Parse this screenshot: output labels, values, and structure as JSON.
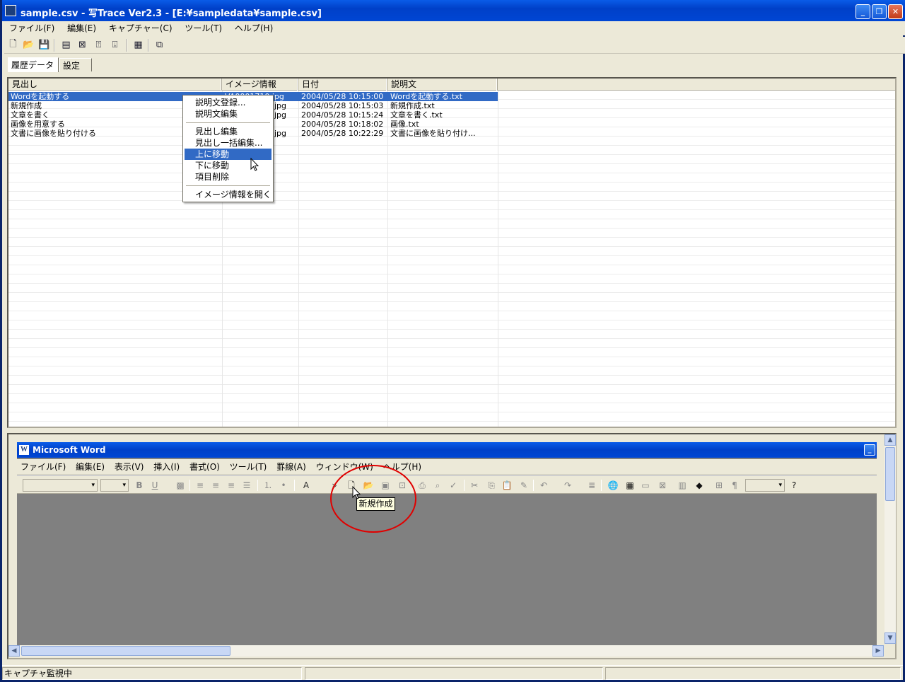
{
  "window": {
    "title": "sample.csv - 写Trace Ver2.3 - [E:¥sampledata¥sample.csv]",
    "min": "_",
    "max": "❐",
    "close": "✕"
  },
  "menubar": {
    "items": [
      "ファイル(F)",
      "編集(E)",
      "キャプチャー(C)",
      "ツール(T)",
      "ヘルプ(H)"
    ]
  },
  "tabs": [
    {
      "label": "履歴データ"
    },
    {
      "label": "設定"
    }
  ],
  "list": {
    "columns": [
      "見出し",
      "イメージ情報",
      "日付",
      "説明文"
    ],
    "rows": [
      {
        "title": "Wordを起動する",
        "image": "VA0001710.jpg",
        "date": "2004/05/28 10:15:00",
        "desc": "Wordを起動する.txt"
      },
      {
        "title": "新規作成",
        "image": "jpg",
        "date": "2004/05/28 10:15:03",
        "desc": "新規作成.txt"
      },
      {
        "title": "文章を書く",
        "image": "jpg",
        "date": "2004/05/28 10:15:24",
        "desc": "文章を書く.txt"
      },
      {
        "title": "画像を用意する",
        "image": "",
        "date": "2004/05/28 10:18:02",
        "desc": "画像.txt"
      },
      {
        "title": "文書に画像を貼り付ける",
        "image": "jpg",
        "date": "2004/05/28 10:22:29",
        "desc": "文書に画像を貼り付け..."
      }
    ]
  },
  "context_menu": {
    "items": [
      "説明文登録...",
      "説明文編集",
      "見出し編集",
      "見出し一括編集...",
      "上に移動",
      "下に移動",
      "項目削除",
      "イメージ情報を開く"
    ],
    "highlighted": "上に移動"
  },
  "preview": {
    "word_title": "Microsoft Word",
    "word_icon": "W",
    "word_menu": [
      "ファイル(F)",
      "編集(E)",
      "表示(V)",
      "挿入(I)",
      "書式(O)",
      "ツール(T)",
      "罫線(A)",
      "ウィンドウ(W)",
      "ヘルプ(H)"
    ],
    "tooltip": "新規作成",
    "highlight_color": "#e00000"
  },
  "status": {
    "text": "キャプチャ監視中"
  },
  "colors": {
    "title_blue": "#0040c8",
    "selection": "#316ac5"
  }
}
